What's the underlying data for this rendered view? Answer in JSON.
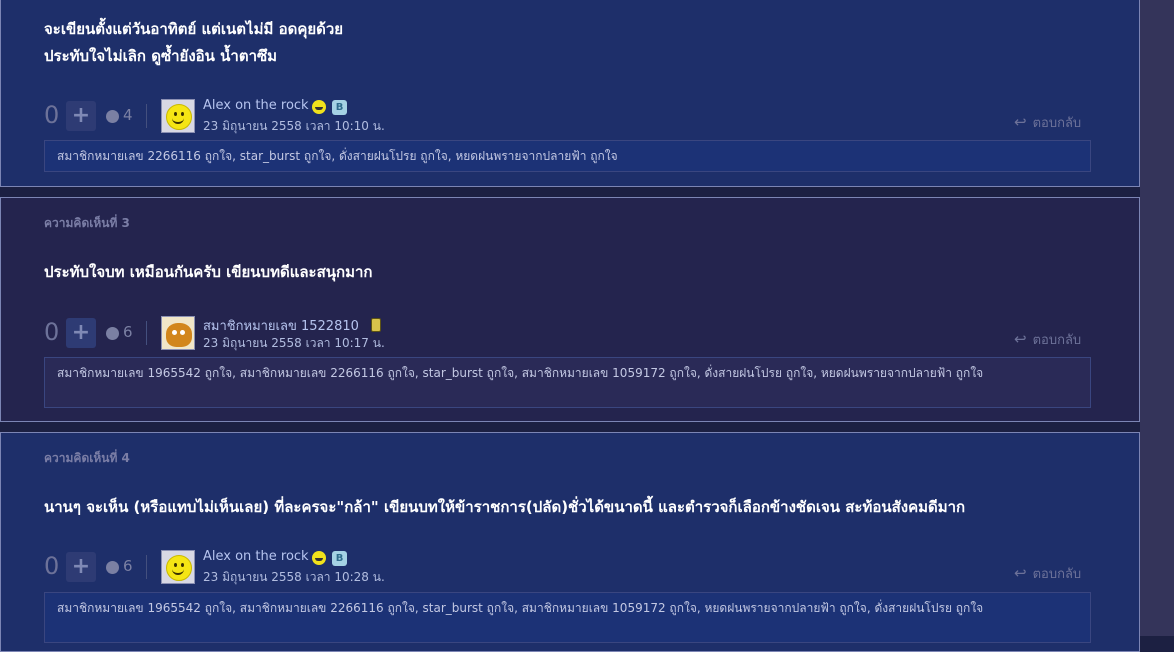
{
  "comment2": {
    "text_line1": "จะเขียนตั้งแต่วันอาทิตย์ แต่เนตไม่มี อดคุยด้วย",
    "text_line2": "ประทับใจไม่เลิก ดูซ้ำยังอิน น้ำตาซึม",
    "vote_count": "0",
    "plus_symbol": "+",
    "emotion_count": "4",
    "user_name": "Alex on the rock",
    "post_time": "23 มิถุนายน 2558 เวลา 10:10 น.",
    "reply_label": "ตอบกลับ",
    "likers": "สมาชิกหมายเลข 2266116 ถูกใจ, star_burst ถูกใจ, ดั่งสายฝนโปรย ถูกใจ, หยดฝนพรายจากปลายฟ้า ถูกใจ"
  },
  "comment3": {
    "label": "ความคิดเห็นที่ 3",
    "text": "ประทับใจบท เหมือนกันครับ เขียนบทดีและสนุกมาก",
    "vote_count": "0",
    "plus_symbol": "+",
    "emotion_count": "6",
    "user_name": "สมาชิกหมายเลข 1522810",
    "post_time": "23 มิถุนายน 2558 เวลา 10:17 น.",
    "reply_label": "ตอบกลับ",
    "likers": "สมาชิกหมายเลข 1965542 ถูกใจ, สมาชิกหมายเลข 2266116 ถูกใจ, star_burst ถูกใจ, สมาชิกหมายเลข 1059172 ถูกใจ, ดั่งสายฝนโปรย ถูกใจ, หยดฝนพรายจากปลายฟ้า ถูกใจ"
  },
  "comment4": {
    "label": "ความคิดเห็นที่ 4",
    "text": "นานๆ จะเห็น (หรือแทบไม่เห็นเลย) ที่ละครจะ\"กล้า\" เขียนบทให้ข้าราชการ(ปลัด)ชั่วได้ขนาดนี้ และตำรวจก็เลือกข้างชัดเจน สะท้อนสังคมดีมาก",
    "vote_count": "0",
    "plus_symbol": "+",
    "emotion_count": "6",
    "user_name": "Alex on the rock",
    "post_time": "23 มิถุนายน 2558 เวลา 10:28 น.",
    "reply_label": "ตอบกลับ",
    "likers": "สมาชิกหมายเลข 1965542 ถูกใจ, สมาชิกหมายเลข 2266116 ถูกใจ, star_burst ถูกใจ, สมาชิกหมายเลข 1059172 ถูกใจ, หยดฝนพรายจากปลายฟ้า ถูกใจ, ดั่งสายฝนโปรย ถูกใจ"
  },
  "icons": {
    "plus": "plus-icon",
    "emotion": "emotion-icon",
    "reply": "reply-arrow-icon",
    "grin_badge": "grin-emoji-icon",
    "blog_badge": "blog-badge-icon",
    "phone_badge": "phone-badge-icon",
    "side": "user-mini-icon"
  },
  "colors": {
    "card_blue": "#1e2f6a",
    "card_dark": "#24244e",
    "text": "#ffffff",
    "muted": "#6d7299"
  }
}
